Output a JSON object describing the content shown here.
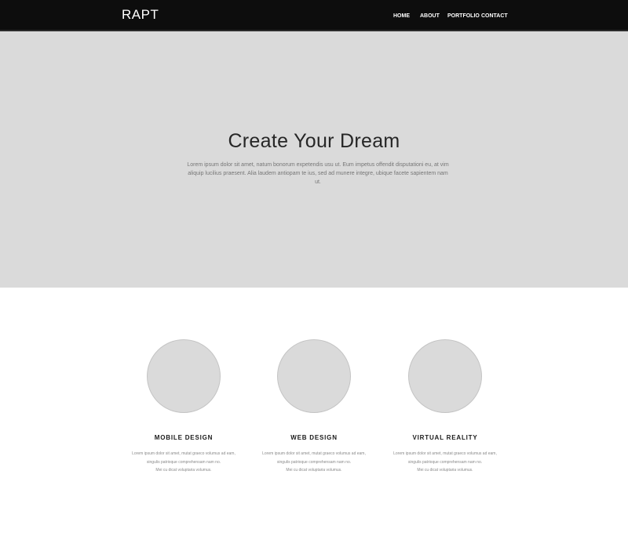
{
  "header": {
    "logo": "RAPT",
    "menu": [
      {
        "label": "HOME"
      },
      {
        "label": "ABOUT"
      },
      {
        "label": "PORTFOLIO"
      },
      {
        "label": "CONTACT"
      }
    ]
  },
  "hero": {
    "title": "Create Your Dream",
    "text": "Lorem ipsum dolor sit amet, natum bonorum expetendis usu ut. Eum impetus offendit disputationi eu, at vim aliquip lucilius praesent. Alia laudem antiopam te ius, sed ad munere integre, ubique facete sapientem nam ut."
  },
  "features": [
    {
      "title": "MOBILE DESIGN",
      "line1": "Lorem ipsum dolor sit amet, mutat graeco volumus ad eam,",
      "line2": "singulis patrioque comprehensam nam no.",
      "line3": "Mei cu dicat voluptaria volumus."
    },
    {
      "title": "WEB DESIGN",
      "line1": "Lorem ipsum dolor sit amet, mutat graeco volumus ad eam,",
      "line2": "singulis patrioque comprehensam nam no.",
      "line3": "Mei cu dicat voluptaria volumus."
    },
    {
      "title": "VIRTUAL REALITY",
      "line1": "Lorem ipsum dolor sit amet, mutat graeco volumus ad eam,",
      "line2": "singulis patrioque comprehensam nam no.",
      "line3": "Mei cu dicat voluptaria volumus."
    }
  ],
  "colors": {
    "nav_background": "#0d0d0d",
    "hero_background": "#dadada",
    "placeholder": "#dadada"
  }
}
